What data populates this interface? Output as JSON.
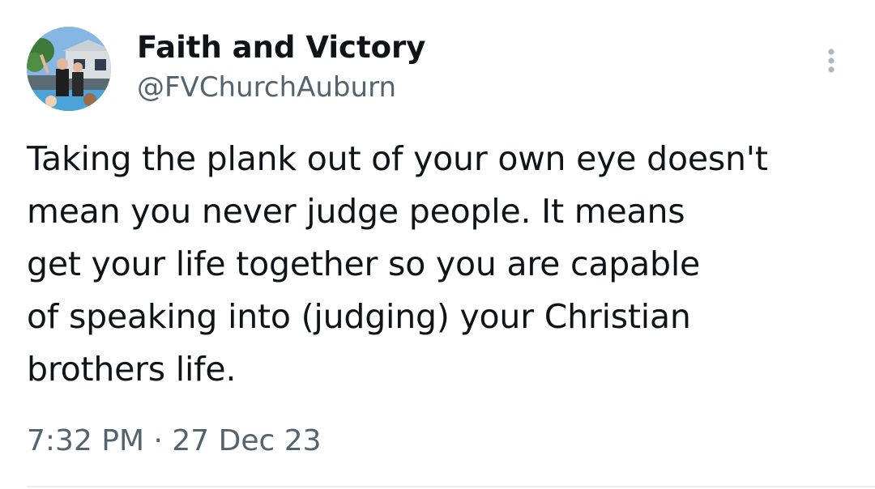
{
  "tweet": {
    "author": {
      "display_name": "Faith and Victory",
      "handle": "@FVChurchAuburn",
      "avatar_icon": "profile-photo"
    },
    "text": "Taking the plank out of your own eye doesn't\nmean you never judge people.  It means\nget your life together so you are capable\nof speaking into (judging) your Christian\nbrothers life.",
    "timestamp": "7:32 PM · 27 Dec 23",
    "more_icon": "more-vertical-icon"
  },
  "colors": {
    "text_primary": "#0f1419",
    "text_secondary": "#536471",
    "divider": "#e6ecf0"
  }
}
